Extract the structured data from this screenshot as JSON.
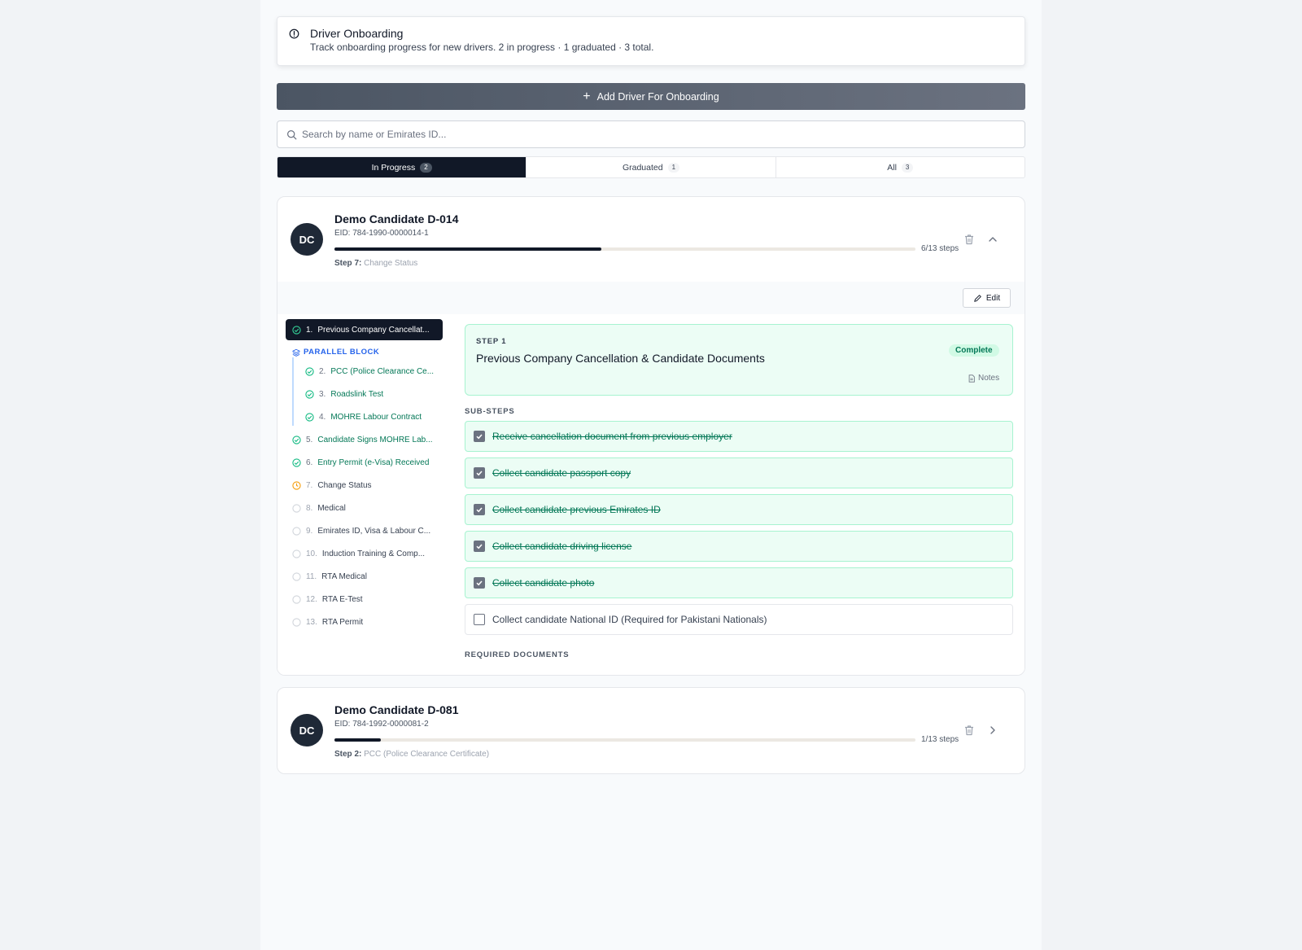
{
  "banner": {
    "title": "Driver Onboarding",
    "description": "Track onboarding progress for new drivers. 2 in progress · 1 graduated · 3 total."
  },
  "add_button": {
    "label": "Add Driver For Onboarding"
  },
  "search": {
    "placeholder": "Search by name or Emirates ID..."
  },
  "tabs": [
    {
      "label": "In Progress",
      "count": "2",
      "active": true
    },
    {
      "label": "Graduated",
      "count": "1",
      "active": false
    },
    {
      "label": "All",
      "count": "3",
      "active": false
    }
  ],
  "candidates": [
    {
      "initials": "DC",
      "name": "Demo Candidate D-014",
      "eid": "EID: 784-1990-0000014-1",
      "progress": 0.46,
      "steps_text": "6/13 steps",
      "current_step_label": "Step 7:",
      "current_step_name": "Change Status",
      "expanded": true
    },
    {
      "initials": "DC",
      "name": "Demo Candidate D-081",
      "eid": "EID: 784-1992-0000081-2",
      "progress": 0.08,
      "steps_text": "1/13 steps",
      "current_step_label": "Step 2:",
      "current_step_name": "PCC (Police Clearance Certificate)",
      "expanded": false
    }
  ],
  "detail": {
    "edit_label": "Edit",
    "parallel_label": "PARALLEL BLOCK",
    "steps": [
      {
        "num": "1.",
        "name": "Previous Company Cancellat...",
        "status": "done"
      },
      {
        "num": "2.",
        "name": "PCC (Police Clearance Ce...",
        "status": "done"
      },
      {
        "num": "3.",
        "name": "Roadslink Test",
        "status": "done"
      },
      {
        "num": "4.",
        "name": "MOHRE Labour Contract",
        "status": "done"
      },
      {
        "num": "5.",
        "name": "Candidate Signs MOHRE Lab...",
        "status": "done"
      },
      {
        "num": "6.",
        "name": "Entry Permit (e-Visa) Received",
        "status": "done"
      },
      {
        "num": "7.",
        "name": "Change Status",
        "status": "current"
      },
      {
        "num": "8.",
        "name": "Medical",
        "status": "pending"
      },
      {
        "num": "9.",
        "name": "Emirates ID, Visa & Labour C...",
        "status": "pending"
      },
      {
        "num": "10.",
        "name": "Induction Training & Comp...",
        "status": "pending"
      },
      {
        "num": "11.",
        "name": "RTA Medical",
        "status": "pending"
      },
      {
        "num": "12.",
        "name": "RTA E-Test",
        "status": "pending"
      },
      {
        "num": "13.",
        "name": "RTA Permit",
        "status": "pending"
      }
    ],
    "selected": {
      "kicker": "STEP 1",
      "title": "Previous Company Cancellation & Candidate Documents",
      "badge": "Complete",
      "notes_label": "Notes",
      "substeps_label": "SUB-STEPS",
      "required_docs_label": "REQUIRED DOCUMENTS",
      "substeps": [
        {
          "text": "Receive cancellation document from previous employer",
          "checked": true
        },
        {
          "text": "Collect candidate passport copy",
          "checked": true
        },
        {
          "text": "Collect candidate previous Emirates ID",
          "checked": true
        },
        {
          "text": "Collect candidate driving license",
          "checked": true
        },
        {
          "text": "Collect candidate photo",
          "checked": true
        },
        {
          "text": "Collect candidate National ID (Required for Pakistani Nationals)",
          "checked": false
        }
      ]
    }
  },
  "colors": {
    "primary": "#111827",
    "complete_green": "#047857",
    "complete_bg": "#ecfdf5",
    "parallel_blue": "#2563eb",
    "in_progress_amber": "#f59e0b"
  }
}
